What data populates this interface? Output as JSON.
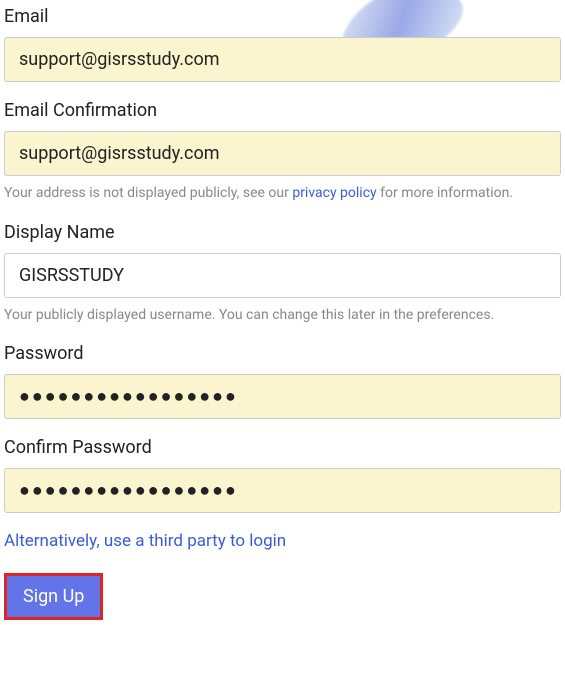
{
  "email": {
    "label": "Email",
    "value": "support@gisrsstudy.com"
  },
  "emailConfirm": {
    "label": "Email Confirmation",
    "value": "support@gisrsstudy.com",
    "helperPrefix": "Your address is not displayed publicly, see our ",
    "helperLink": "privacy policy",
    "helperSuffix": " for more information."
  },
  "displayName": {
    "label": "Display Name",
    "value": "GISRSSTUDY",
    "helper": "Your publicly displayed username. You can change this later in the preferences."
  },
  "password": {
    "label": "Password",
    "value": "●●●●●●●●●●●●●●●●●"
  },
  "confirmPassword": {
    "label": "Confirm Password",
    "value": "●●●●●●●●●●●●●●●●●"
  },
  "altLogin": "Alternatively, use a third party to login",
  "signUp": "Sign Up"
}
